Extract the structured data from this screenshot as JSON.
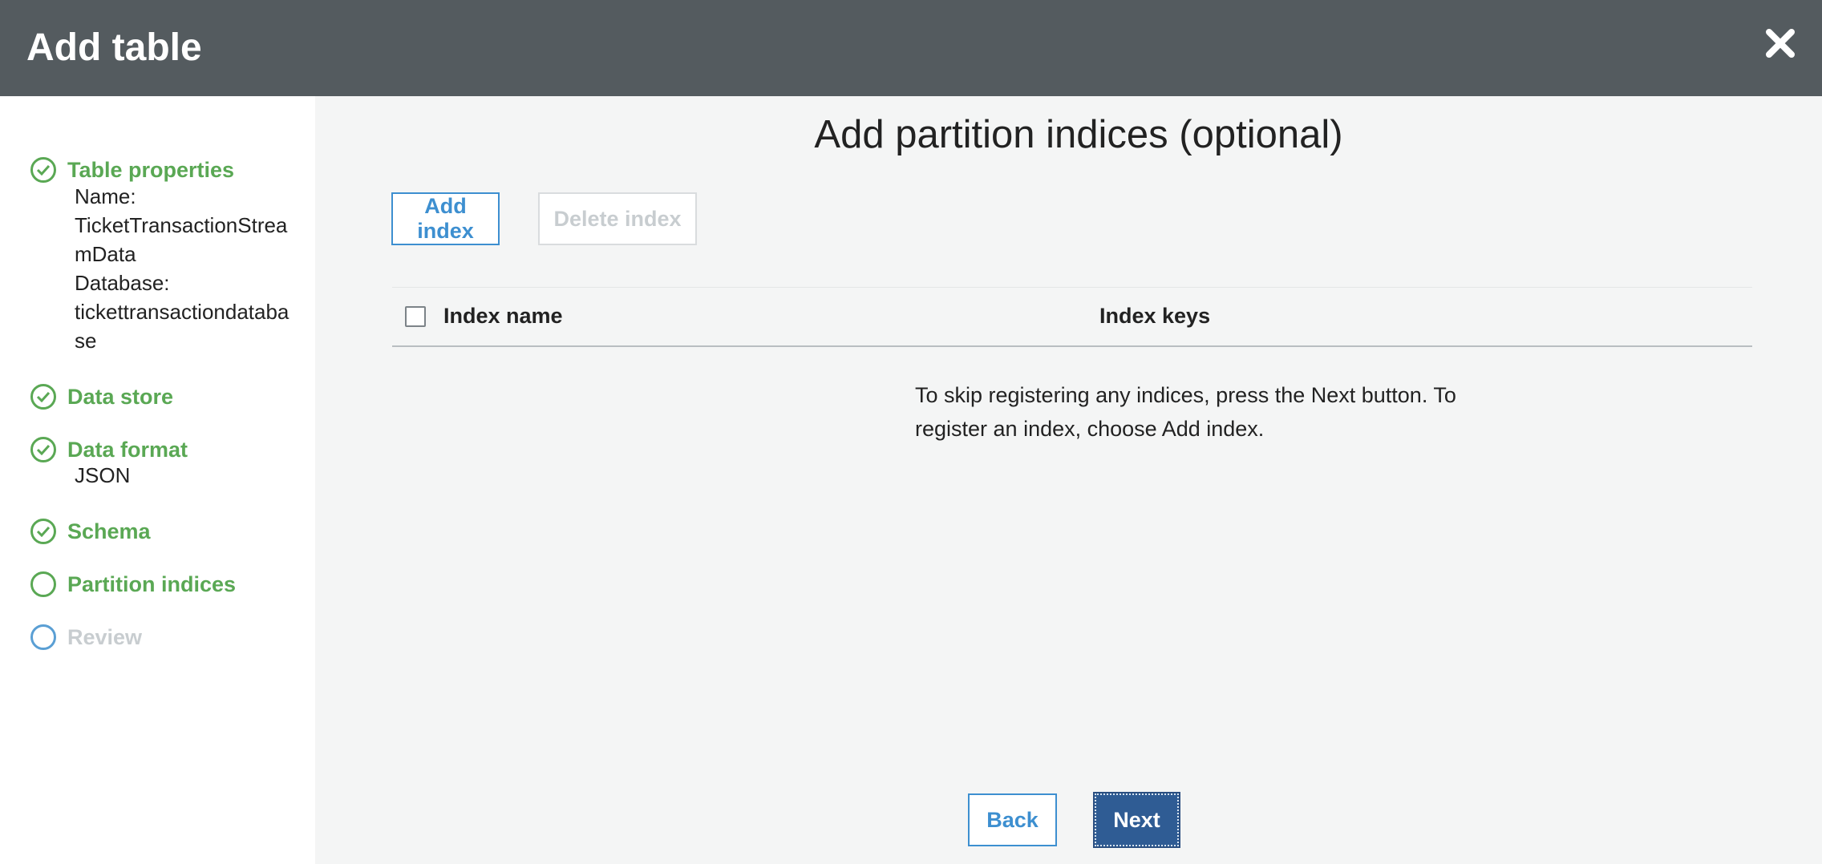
{
  "header": {
    "title": "Add table",
    "close_icon": "close-icon"
  },
  "sidebar": {
    "steps": [
      {
        "label": "Table properties",
        "status": "complete",
        "details": [
          "Name:",
          "TicketTransactionStreamData",
          "Database:",
          "tickettransactiondatabase"
        ]
      },
      {
        "label": "Data store",
        "status": "complete"
      },
      {
        "label": "Data format",
        "status": "complete",
        "details": [
          "JSON"
        ]
      },
      {
        "label": "Schema",
        "status": "complete"
      },
      {
        "label": "Partition indices",
        "status": "current"
      },
      {
        "label": "Review",
        "status": "future"
      }
    ]
  },
  "main": {
    "title": "Add partition indices (optional)",
    "add_index_label": "Add index",
    "delete_index_label": "Delete index",
    "table": {
      "columns": [
        "Index name",
        "Index keys"
      ],
      "empty_message": "To skip registering any indices, press the Next button. To register an index, choose Add index."
    },
    "back_label": "Back",
    "next_label": "Next"
  },
  "colors": {
    "header_bg": "#545b5f",
    "complete_green": "#5aa854",
    "link_blue": "#3d8fd0",
    "primary_button": "#2f5c94",
    "disabled_text": "#c8cdd0"
  }
}
